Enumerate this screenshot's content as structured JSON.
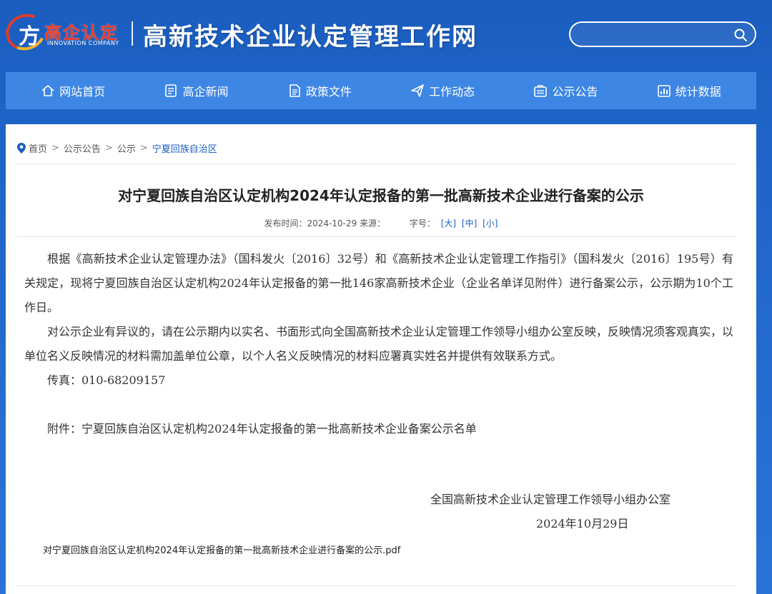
{
  "header": {
    "logo_mark": "方",
    "logo_cn": "高企认定",
    "logo_en": "INNOVATION COMPANY",
    "site_title": "高新技术企业认定管理工作网",
    "search_placeholder": ""
  },
  "nav": {
    "items": [
      {
        "label": "网站首页",
        "icon": "home-icon"
      },
      {
        "label": "高企新闻",
        "icon": "news-icon"
      },
      {
        "label": "政策文件",
        "icon": "document-icon"
      },
      {
        "label": "工作动态",
        "icon": "send-icon"
      },
      {
        "label": "公示公告",
        "icon": "announcement-icon"
      },
      {
        "label": "统计数据",
        "icon": "chart-icon"
      }
    ]
  },
  "breadcrumb": {
    "items": [
      "首页",
      "公示公告",
      "公示"
    ],
    "current": "宁夏回族自治区",
    "separator": ">"
  },
  "article": {
    "title": "对宁夏回族自治区认定机构2024年认定报备的第一批高新技术企业进行备案的公示",
    "meta_publish": "发布时间：2024-10-29 来源：",
    "meta_fontsize_label": "字号：",
    "fs_large": "[大]",
    "fs_medium": "[中]",
    "fs_small": "[小]",
    "paragraphs": [
      "根据《高新技术企业认定管理办法》（国科发火〔2016〕32号）和《高新技术企业认定管理工作指引》（国科发火〔2016〕195号）有关规定，现将宁夏回族自治区认定机构2024年认定报备的第一批146家高新技术企业（企业名单详见附件）进行备案公示，公示期为10个工作日。",
      "对公示企业有异议的，请在公示期内以实名、书面形式向全国高新技术企业认定管理工作领导小组办公室反映，反映情况须客观真实，以单位名义反映情况的材料需加盖单位公章，以个人名义反映情况的材料应署真实姓名并提供有效联系方式。",
      "传真：010-68209157"
    ],
    "attachment": "附件：宁夏回族自治区认定机构2024年认定报备的第一批高新技术企业备案公示名单",
    "sign_org": "全国高新技术企业认定管理工作领导小组办公室",
    "sign_date": "2024年10月29日",
    "pdf_link": "对宁夏回族自治区认定机构2024年认定报备的第一批高新技术企业进行备案的公示.pdf"
  },
  "colors": {
    "nav_bg": "#3e86e4",
    "link": "#1a5fc5",
    "logo_red": "#e83b2a"
  }
}
